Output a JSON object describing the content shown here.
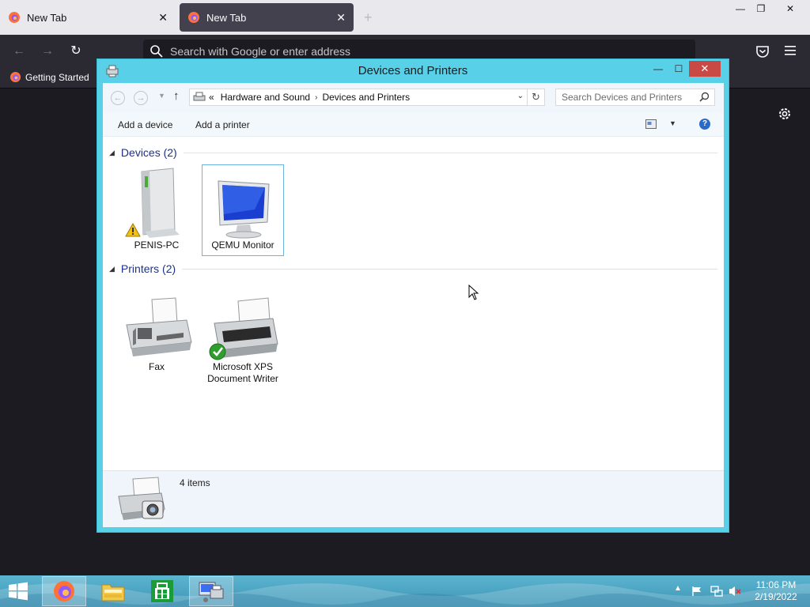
{
  "browser": {
    "tabs": [
      {
        "label": "New Tab"
      },
      {
        "label": "New Tab"
      }
    ],
    "new_tab_symbol": "+",
    "address_placeholder": "Search with Google or enter address",
    "bookmarks": [
      {
        "label": "Getting Started"
      }
    ],
    "window_buttons": {
      "minimize": "—",
      "restore": "❐",
      "close": "✕"
    }
  },
  "explorer": {
    "title": "Devices and Printers",
    "breadcrumb": {
      "overflow": "«",
      "items": [
        "Hardware and Sound",
        "Devices and Printers"
      ],
      "separator": "›"
    },
    "search_placeholder": "Search Devices and Printers",
    "commands": {
      "add_device": "Add a device",
      "add_printer": "Add a printer"
    },
    "groups": {
      "devices": {
        "label": "Devices (2)",
        "items": [
          {
            "label": "PENIS-PC",
            "icon": "computer-tower-icon",
            "warning": true
          },
          {
            "label": "QEMU Monitor",
            "icon": "monitor-icon",
            "selected": true
          }
        ]
      },
      "printers": {
        "label": "Printers (2)",
        "items": [
          {
            "label": "Fax",
            "icon": "fax-icon"
          },
          {
            "label_line1": "Microsoft XPS",
            "label_line2": "Document Writer",
            "icon": "printer-icon",
            "default": true
          }
        ]
      }
    },
    "status": {
      "text": "4 items"
    }
  },
  "taskbar": {
    "apps": [
      {
        "name": "firefox",
        "active": true
      },
      {
        "name": "file-explorer",
        "active": false
      },
      {
        "name": "store",
        "active": false
      },
      {
        "name": "devices-and-printers",
        "active": true
      }
    ],
    "clock": {
      "time": "11:06 PM",
      "date": "2/19/2022"
    }
  },
  "colors": {
    "window_frame": "#57d0e8",
    "close_button": "#c94a45",
    "group_header": "#1e3287",
    "ff_toolbar": "#2b2a33",
    "ff_tabbar": "#e9e9ed"
  }
}
